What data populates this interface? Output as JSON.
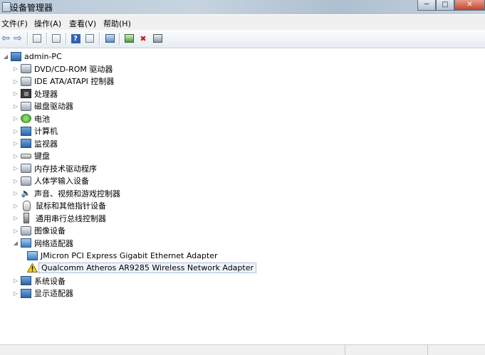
{
  "window": {
    "title": "设备管理器",
    "minimize": "─",
    "maximize": "□",
    "close": "✕"
  },
  "menu": {
    "items": [
      "文件(F)",
      "操作(A)",
      "查看(V)",
      "帮助(H)"
    ]
  },
  "toolbar": {
    "back": "⇦",
    "forward": "⇨"
  },
  "tree": {
    "root": "admin-PC",
    "items": [
      {
        "label": "DVD/CD-ROM 驱动器",
        "icon": "disc-drive-icon"
      },
      {
        "label": "IDE ATA/ATAPI 控制器",
        "icon": "ide-controller-icon"
      },
      {
        "label": "处理器",
        "icon": "processor-icon"
      },
      {
        "label": "磁盘驱动器",
        "icon": "disk-drive-icon"
      },
      {
        "label": "电池",
        "icon": "battery-icon"
      },
      {
        "label": "计算机",
        "icon": "computer-icon"
      },
      {
        "label": "监视器",
        "icon": "monitor-icon"
      },
      {
        "label": "键盘",
        "icon": "keyboard-icon"
      },
      {
        "label": "内存技术驱动程序",
        "icon": "memory-technology-icon"
      },
      {
        "label": "人体学输入设备",
        "icon": "hid-icon"
      },
      {
        "label": "声音、视频和游戏控制器",
        "icon": "sound-icon"
      },
      {
        "label": "鼠标和其他指针设备",
        "icon": "mouse-icon"
      },
      {
        "label": "通用串行总线控制器",
        "icon": "usb-icon"
      },
      {
        "label": "图像设备",
        "icon": "imaging-device-icon"
      },
      {
        "label": "网络适配器",
        "icon": "network-adapter-icon"
      }
    ],
    "network_children": [
      {
        "label": "JMicron PCI Express Gigabit Ethernet Adapter",
        "icon": "network-card-icon"
      },
      {
        "label": "Qualcomm Atheros AR9285 Wireless Network Adapter",
        "icon": "warning-icon"
      }
    ],
    "tail_items": [
      {
        "label": "系统设备",
        "icon": "system-device-icon"
      },
      {
        "label": "显示适配器",
        "icon": "display-adapter-icon"
      }
    ],
    "collapsed_glyph": "▷",
    "expanded_glyph": "◢"
  }
}
